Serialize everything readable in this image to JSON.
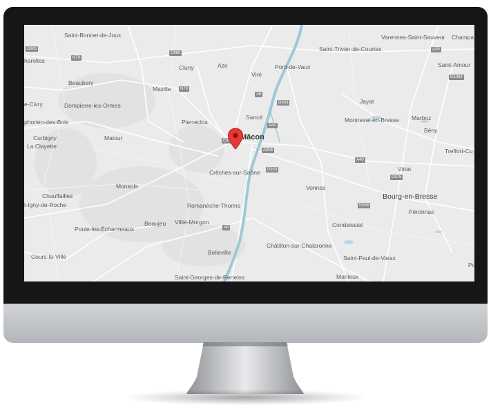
{
  "map": {
    "places": [
      {
        "id": "saint-bonnet-de-joux",
        "label": "Saint-Bonnet-de-Joux"
      },
      {
        "id": "charolles",
        "label": "harolles"
      },
      {
        "id": "beaubery",
        "label": "Beaubery"
      },
      {
        "id": "civry",
        "label": "e-Civry"
      },
      {
        "id": "dompierre",
        "label": "Dompierre-les-Ormes"
      },
      {
        "id": "symphorien",
        "label": "phorien-des-Bois"
      },
      {
        "id": "curbigny",
        "label": "Curbigny"
      },
      {
        "id": "la-clayette",
        "label": "La Clayette"
      },
      {
        "id": "matour",
        "label": "Matour"
      },
      {
        "id": "cluny",
        "label": "Cluny"
      },
      {
        "id": "aze",
        "label": "Azé"
      },
      {
        "id": "mazille",
        "label": "Mazille"
      },
      {
        "id": "viré",
        "label": "Viré"
      },
      {
        "id": "pont-de-vaux",
        "label": "Pont-de-Vaux"
      },
      {
        "id": "saint-trivier",
        "label": "Saint-Trivier-de-Courtes"
      },
      {
        "id": "varennes",
        "label": "Varennes-Saint-Sauveur"
      },
      {
        "id": "champa",
        "label": "Champa"
      },
      {
        "id": "saint-amour",
        "label": "Saint-Amour"
      },
      {
        "id": "pierreclos",
        "label": "Pierreclos"
      },
      {
        "id": "sance",
        "label": "Sancé"
      },
      {
        "id": "macon",
        "label": "Mâcon"
      },
      {
        "id": "jayat",
        "label": "Jayat"
      },
      {
        "id": "montrevel",
        "label": "Montrevel-en-Bresse"
      },
      {
        "id": "marboz",
        "label": "Marboz"
      },
      {
        "id": "beny",
        "label": "Bény"
      },
      {
        "id": "treffort",
        "label": "Treffort-Cu"
      },
      {
        "id": "creches",
        "label": "Crêches-sur-Saône"
      },
      {
        "id": "viriat",
        "label": "Viriat"
      },
      {
        "id": "bourg",
        "label": "Bourg-en-Bresse"
      },
      {
        "id": "vonnas",
        "label": "Vonnas"
      },
      {
        "id": "monsols",
        "label": "Monsols"
      },
      {
        "id": "chauffailles",
        "label": "Chauffailles"
      },
      {
        "id": "igny-de-roche",
        "label": "t-Igny-de-Roche"
      },
      {
        "id": "romaneche",
        "label": "Romanèche-Thorins"
      },
      {
        "id": "peronnas",
        "label": "Péronnas"
      },
      {
        "id": "poule",
        "label": "Poule-les-Écharmeaux"
      },
      {
        "id": "beaujeu",
        "label": "Beaujeu"
      },
      {
        "id": "villie",
        "label": "Villié-Morgon"
      },
      {
        "id": "condeissiat",
        "label": "Condeissiat"
      },
      {
        "id": "chatillon",
        "label": "Châtillon-sur-Chalaronne"
      },
      {
        "id": "belleville",
        "label": "Belleville"
      },
      {
        "id": "cours",
        "label": "Cours-la-Ville"
      },
      {
        "id": "saint-paul",
        "label": "Saint-Paul-de-Varax"
      },
      {
        "id": "saint-georges",
        "label": "Saint-Georges-de-Reneins"
      },
      {
        "id": "marlieux",
        "label": "Marlieux"
      },
      {
        "id": "po",
        "label": "Po"
      }
    ],
    "roads": [
      "D985",
      "N79",
      "D980",
      "N79",
      "A6",
      "D933",
      "A40",
      "A406",
      "E62",
      "A40",
      "D975",
      "D933",
      "D936",
      "A6",
      "A39",
      "D1083"
    ],
    "marker": {
      "name": "location-pin",
      "color": "#e53935",
      "city": "Mâcon"
    },
    "colors": {
      "water": "#9fc7d8",
      "land": "#ebebeb",
      "road": "#ffffff"
    }
  }
}
